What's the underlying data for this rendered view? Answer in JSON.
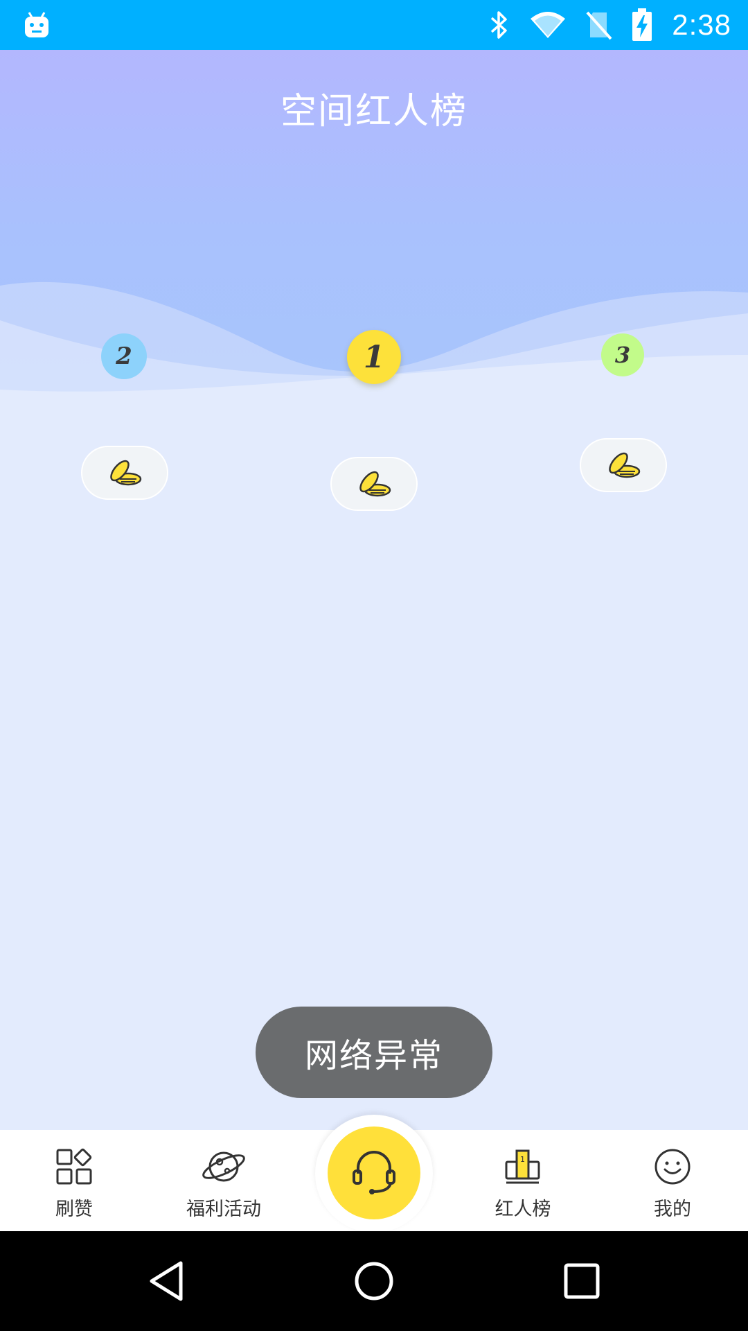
{
  "status_bar": {
    "time": "2:38",
    "icons": [
      "android-notification-icon",
      "bluetooth-icon",
      "wifi-icon",
      "no-sim-icon",
      "battery-charging-icon"
    ],
    "background": "#00b0ff"
  },
  "header": {
    "title": "空间红人榜"
  },
  "ranking": {
    "first": {
      "rank": "1",
      "color": "#fde13a"
    },
    "second": {
      "rank": "2",
      "color": "#8dd2fb"
    },
    "third": {
      "rank": "3",
      "color": "#c2fb8a"
    },
    "coin_icon": "coin-stack-icon"
  },
  "toast": {
    "message": "网络异常"
  },
  "bottom_nav": {
    "items": [
      {
        "label": "刷赞",
        "icon": "grid-apps-icon"
      },
      {
        "label": "福利活动",
        "icon": "planet-icon"
      },
      {
        "label": "",
        "icon": "headset-icon"
      },
      {
        "label": "红人榜",
        "icon": "podium-icon"
      },
      {
        "label": "我的",
        "icon": "smiley-face-icon"
      }
    ],
    "accent": "#ffe03a"
  },
  "system_nav": {
    "buttons": [
      "back-icon",
      "home-icon",
      "recent-apps-icon"
    ]
  }
}
